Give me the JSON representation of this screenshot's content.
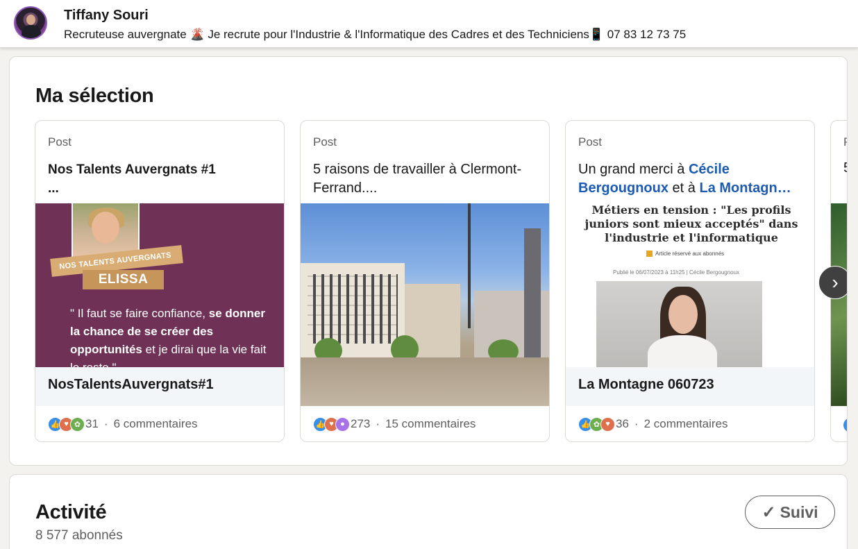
{
  "header": {
    "name": "Tiffany Souri",
    "headline": "Recruteuse auvergnate 🌋 Je recrute pour l'Industrie & l'Informatique des Cadres et des Techniciens📱 07 83 12 73 75"
  },
  "selection": {
    "title": "Ma sélection",
    "posts": [
      {
        "type": "Post",
        "text_line1": "Nos Talents Auvergnats #1",
        "text_line2": "...",
        "media": {
          "ribbon": "NOS TALENTS AUVERGNATS",
          "label": "ELISSA",
          "quote_part1": "\" Il faut se faire confiance, ",
          "quote_bold1": "se donner la chance de se créer des opportunités",
          "quote_part2": " et je dirai que la vie fait le reste \""
        },
        "caption": "NosTalentsAuvergnats#1",
        "reactions_count": "31",
        "comments": "6 commentaires"
      },
      {
        "type": "Post",
        "text": "5 raisons de travailler à Clermont-Ferrand....",
        "reactions_count": "273",
        "comments": "15 commentaires"
      },
      {
        "type": "Post",
        "text_prefix": "Un grand merci à ",
        "mention1": "Cécile Bergougnoux",
        "text_mid": " et à ",
        "mention2": "La Montagn…",
        "media": {
          "headline": "Métiers en tension : \"Les profils juniors sont mieux acceptés\" dans l'industrie et l'informatique",
          "badge": "Article réservé aux abonnés",
          "meta": "Publié le 06/07/2023 à 11h25 | Cécile Bergougnoux"
        },
        "caption": "La Montagne 060723",
        "reactions_count": "36",
        "comments": "2 commentaires"
      },
      {
        "type": "P",
        "text": "5"
      }
    ],
    "next_label": "›"
  },
  "activity": {
    "title": "Activité",
    "followers": "8 577 abonnés",
    "follow_button": "Suivi",
    "follow_check": "✓"
  },
  "colors": {
    "link": "#1b5bb3",
    "like": "#378fe9",
    "love": "#df704d",
    "support": "#6dae4f",
    "insight": "#a872e8"
  }
}
